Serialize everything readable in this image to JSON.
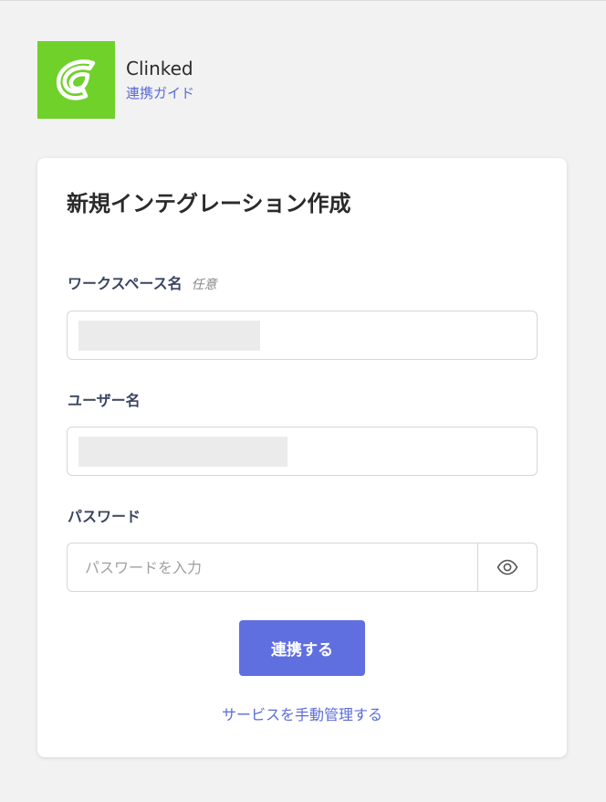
{
  "app": {
    "name": "Clinked",
    "guide_link": "連携ガイド",
    "logo_color": "#6fd12a"
  },
  "form": {
    "title": "新規インテグレーション作成",
    "workspace": {
      "label": "ワークスペース名",
      "optional_tag": "任意",
      "value": ""
    },
    "username": {
      "label": "ユーザー名",
      "value": ""
    },
    "password": {
      "label": "パスワード",
      "placeholder": "パスワードを入力",
      "toggle_icon": "eye-icon"
    },
    "submit_label": "連携する",
    "manual_link": "サービスを手動管理する"
  },
  "colors": {
    "accent": "#5f6fe0",
    "link": "#5a6bd8",
    "background": "#f2f2f2"
  }
}
